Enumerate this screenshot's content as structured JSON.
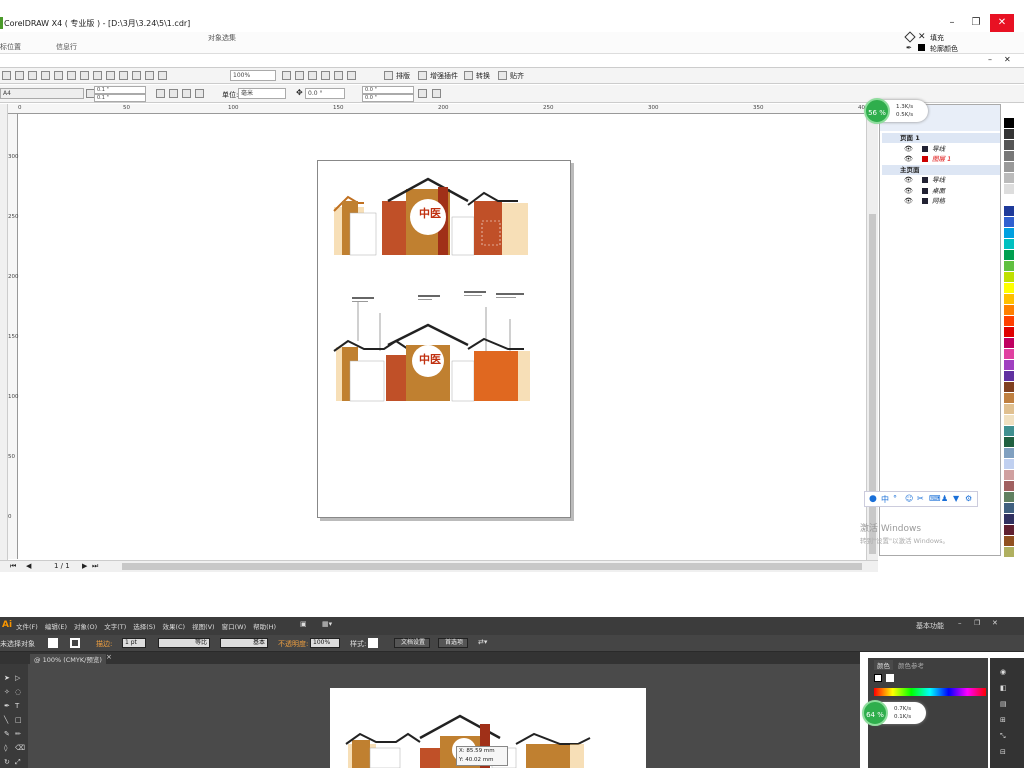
{
  "corel": {
    "title": "CorelDRAW X4 ( 专业版 ) - [D:\\3月\\3.24\\5\\1.cdr]",
    "menu_left": "标位置",
    "menu_mid": "信息行",
    "menu_label": "对象选集",
    "fill_label": "填充",
    "outline_label": "轮廓颜色",
    "page_size": "A4",
    "w_val": "0.1 \"",
    "h_val": "0.1 \"",
    "zoom": "100%",
    "unit_label": "单位:",
    "unit_value": "毫米",
    "angle": "0.0 °",
    "x_val": "0.0 \"",
    "y_val": "0.0 \"",
    "toolbar": [
      "排版",
      "增强插件",
      "转换",
      "贴齐"
    ],
    "ruler_ticks": [
      "0",
      "50",
      "100",
      "150",
      "200",
      "250",
      "300",
      "350",
      "400"
    ],
    "vruler_ticks": [
      "300",
      "250",
      "200",
      "150",
      "100",
      "50",
      "0"
    ],
    "page_nav": "1 / 1",
    "layers": [
      {
        "label": "页面 1",
        "type": "page"
      },
      {
        "label": "导线",
        "type": "layer"
      },
      {
        "label": "图层 1",
        "type": "layer-active"
      },
      {
        "label": "主页面",
        "type": "page"
      },
      {
        "label": "导线",
        "type": "layer"
      },
      {
        "label": "桌面",
        "type": "layer"
      },
      {
        "label": "网格",
        "type": "layer"
      }
    ],
    "activate_windows": "激活 Windows",
    "activate_hint": "转到\"设置\"以激活 Windows。",
    "badge_pct": "56 %",
    "badge_up": "1.3K/s",
    "badge_down": "0.5K/s",
    "art_title_a": "中医",
    "art_title_b": "中医"
  },
  "illustrator": {
    "logo": "Ai",
    "menus": [
      "文件(F)",
      "编辑(E)",
      "对象(O)",
      "文字(T)",
      "选择(S)",
      "效果(C)",
      "视图(V)",
      "窗口(W)",
      "帮助(H)"
    ],
    "workspace": "基本功能",
    "no_selection": "未选择对象",
    "stroke_label": "描边:",
    "stroke_value": "1 pt",
    "profile1": "等比",
    "profile2": "基本",
    "opacity_label": "不透明度:",
    "opacity_value": "100%",
    "style_label": "样式:",
    "doc_settings": "文档设置",
    "preferences": "首选项",
    "tab": "@ 100% (CMYK/预览)",
    "panel_tab1": "颜色",
    "panel_tab2": "颜色参考",
    "badge_pct": "64 %",
    "badge_up": "0.7K/s",
    "badge_down": "0.1K/s",
    "coord_x": "X: 85.59 mm",
    "coord_y": "Y: 40.02 mm"
  },
  "palette_colors": [
    "#000000",
    "#333333",
    "#555555",
    "#777777",
    "#999999",
    "#bbbbbb",
    "#dddddd",
    "#ffffff",
    "#1e3a9a",
    "#3060d0",
    "#00a0e0",
    "#00c0c0",
    "#00a050",
    "#60c040",
    "#c0e000",
    "#ffff00",
    "#ffc000",
    "#ff8000",
    "#ff4000",
    "#e00000",
    "#c00060",
    "#e040a0",
    "#a040c0",
    "#6030a0",
    "#804020",
    "#c08040",
    "#e0c090",
    "#f0e0c0",
    "#409090",
    "#206040",
    "#80a0c0",
    "#c0d0f0",
    "#d0a0a0",
    "#a06060",
    "#608060",
    "#406080",
    "#303060",
    "#602030",
    "#905020",
    "#b0b060"
  ]
}
